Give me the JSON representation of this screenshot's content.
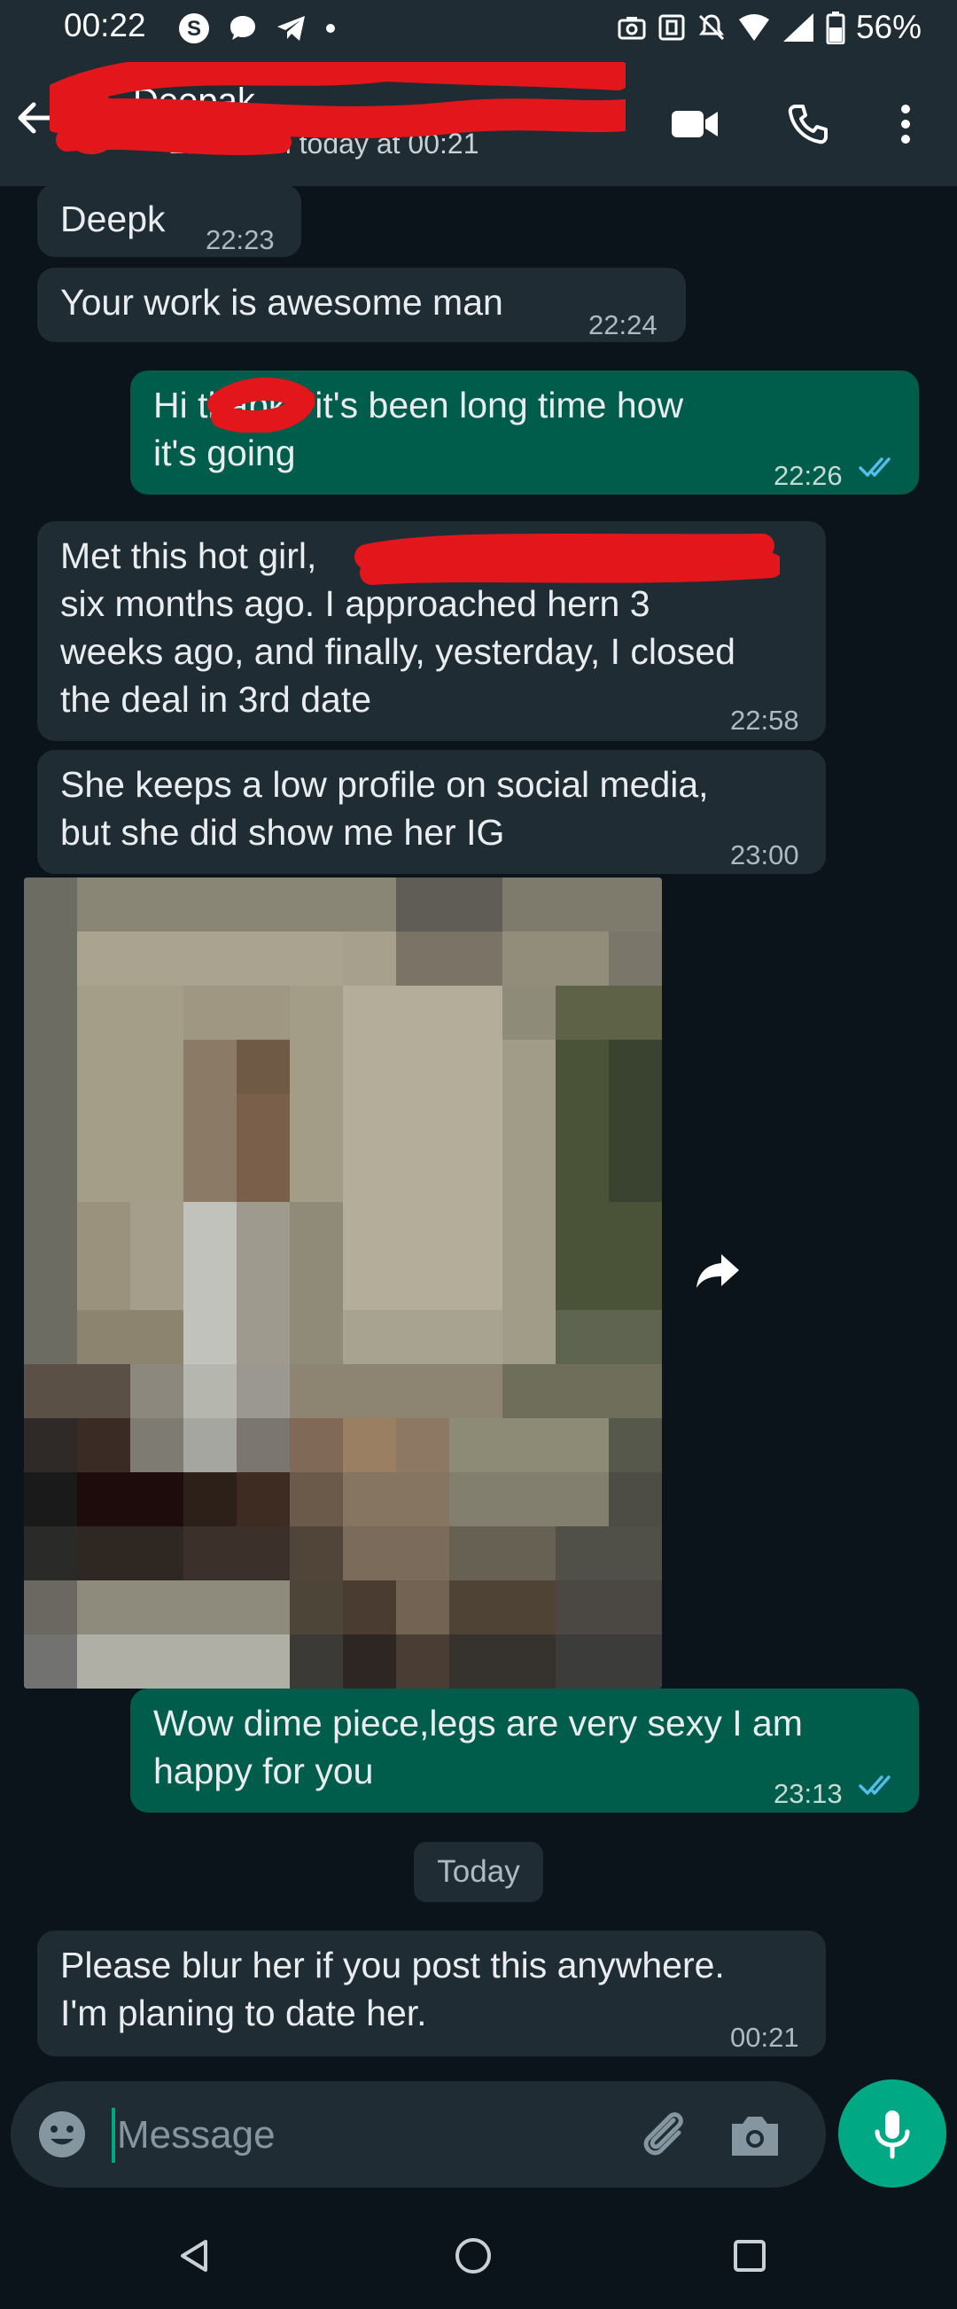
{
  "status_bar": {
    "time": "00:22",
    "battery_percent": "56%"
  },
  "header": {
    "contact_name": "Deepak",
    "last_seen": "Last seen today at 00:21"
  },
  "messages": [
    {
      "direction": "incoming",
      "text": "Deepk",
      "time": "22:23"
    },
    {
      "direction": "incoming",
      "text": "Your work is awesome man",
      "time": "22:24"
    },
    {
      "direction": "outgoing",
      "text": "Hi       thabks it's been long time how\nit's going",
      "time": "22:26",
      "read": true
    },
    {
      "direction": "incoming",
      "text": "Met this hot girl,\nsix months ago. I approached hern 3\nweeks ago, and finally, yesterday, I closed\nthe deal in 3rd date",
      "time": "22:58"
    },
    {
      "direction": "incoming",
      "text": "She keeps a low profile on social media,\nbut she did show me her IG",
      "time": "23:00"
    },
    {
      "direction": "outgoing",
      "text": "Wow dime piece,legs are very sexy I am\nhappy for you",
      "time": "23:13",
      "read": true
    },
    {
      "direction": "incoming",
      "text": "Please blur her if you post this anywhere.\nI'm planing to date her.",
      "time": "00:21"
    }
  ],
  "date_separator": "Today",
  "composer": {
    "placeholder": "Message"
  },
  "colors": {
    "background": "#0b141a",
    "bar": "#1f2c34",
    "incoming_bubble": "#202c33",
    "outgoing_bubble": "#005c4b",
    "accent": "#00a884",
    "read_ticks": "#53bdeb"
  },
  "icons": {
    "status_left": [
      "skype-icon",
      "chat-bubble-icon",
      "telegram-icon",
      "dot-icon"
    ],
    "status_right": [
      "camera-status-icon",
      "nfc-icon",
      "mute-icon",
      "wifi-icon",
      "signal-icon",
      "battery-icon"
    ],
    "header": [
      "back-arrow-icon",
      "video-call-icon",
      "phone-icon",
      "more-vert-icon"
    ],
    "composer": [
      "emoji-icon",
      "attach-icon",
      "camera-icon",
      "mic-icon"
    ],
    "nav": [
      "nav-back-icon",
      "nav-home-icon",
      "nav-recents-icon"
    ]
  }
}
